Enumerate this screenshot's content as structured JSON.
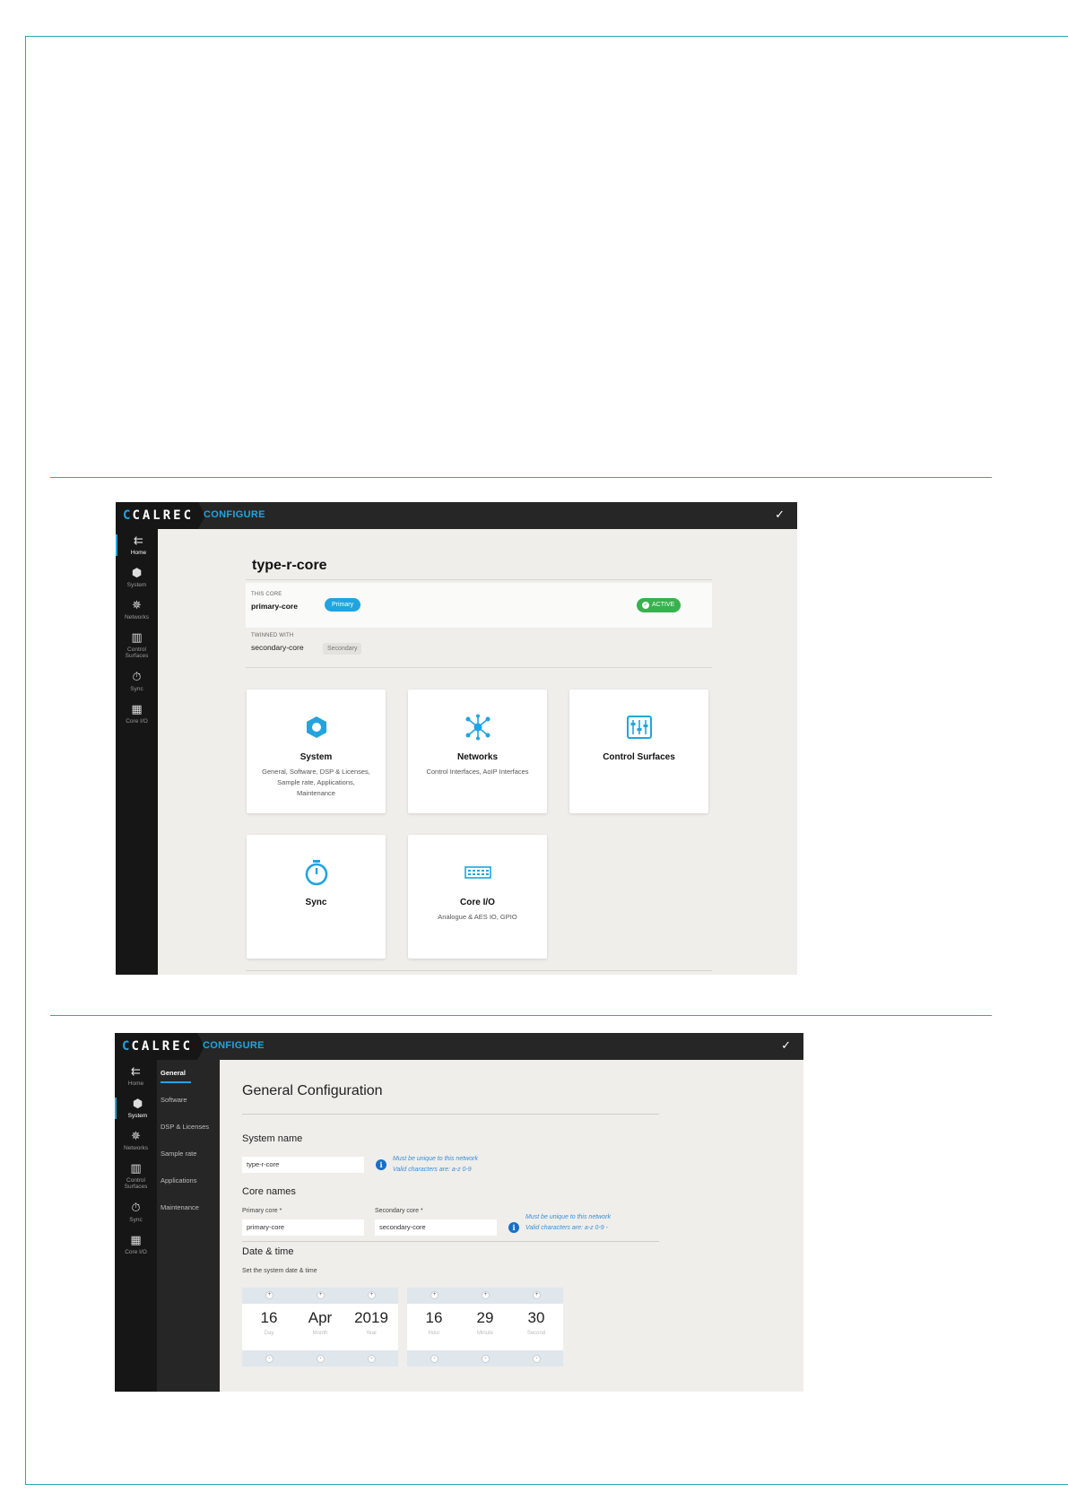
{
  "screen1": {
    "brand": {
      "logo": "CALREC",
      "section": "CONFIGURE",
      "confirm_icon": "✓"
    },
    "rail": [
      {
        "icon": "home-arrow-icon",
        "glyph": "⇇",
        "label": "Home",
        "active": true
      },
      {
        "icon": "hexagon-icon",
        "glyph": "⬢",
        "label": "System"
      },
      {
        "icon": "network-icon",
        "glyph": "✵",
        "label": "Networks"
      },
      {
        "icon": "faders-icon",
        "glyph": "▥",
        "label": "Control Surfaces"
      },
      {
        "icon": "stopwatch-icon",
        "glyph": "⏱",
        "label": "Sync"
      },
      {
        "icon": "io-ports-icon",
        "glyph": "▦",
        "label": "Core I/O"
      }
    ],
    "core_title": "type-r-core",
    "this_core": {
      "caption": "THIS CORE",
      "name": "primary-core",
      "role": "Primary",
      "status": "ACTIVE"
    },
    "twinned": {
      "caption": "TWINNED WITH",
      "name": "secondary-core",
      "role": "Secondary"
    },
    "cards": [
      {
        "title": "System",
        "subtitle": "General, Software, DSP & Licenses, Sample rate, Applications, Maintenance",
        "icon": "hexagon-icon"
      },
      {
        "title": "Networks",
        "subtitle": "Control Interfaces, AoIP Interfaces",
        "icon": "network-icon"
      },
      {
        "title": "Control Surfaces",
        "subtitle": "",
        "icon": "faders-icon"
      },
      {
        "title": "Sync",
        "subtitle": "",
        "icon": "stopwatch-icon"
      },
      {
        "title": "Core I/O",
        "subtitle": "Analogue & AES IO, GPIO",
        "icon": "io-ports-icon"
      }
    ],
    "colors": {
      "accent": "#21a4e0",
      "active": "#37b24d",
      "chrome": "#262626"
    }
  },
  "screen2": {
    "brand": {
      "logo": "CALREC",
      "section": "CONFIGURE",
      "confirm_icon": "✓"
    },
    "rail": [
      {
        "icon": "home-arrow-icon",
        "glyph": "⇇",
        "label": "Home"
      },
      {
        "icon": "hexagon-icon",
        "glyph": "⬢",
        "label": "System",
        "active": true
      },
      {
        "icon": "network-icon",
        "glyph": "✵",
        "label": "Networks"
      },
      {
        "icon": "faders-icon",
        "glyph": "▥",
        "label": "Control Surfaces"
      },
      {
        "icon": "stopwatch-icon",
        "glyph": "⏱",
        "label": "Sync"
      },
      {
        "icon": "io-ports-icon",
        "glyph": "▦",
        "label": "Core I/O"
      }
    ],
    "subnav": [
      "General",
      "Software",
      "DSP & Licenses",
      "Sample rate",
      "Applications",
      "Maintenance"
    ],
    "title": "General Configuration",
    "system_name": {
      "heading": "System name",
      "value": "type-r-core",
      "hint1": "Must be unique to this network",
      "hint2": "Valid characters are: a-z 0-9"
    },
    "core_names": {
      "heading": "Core names",
      "primary_label": "Primary core *",
      "primary_value": "primary-core",
      "secondary_label": "Secondary core *",
      "secondary_value": "secondary-core",
      "hint1": "Must be unique to this network",
      "hint2": "Valid characters are: a-z 0-9 -"
    },
    "datetime": {
      "heading": "Date & time",
      "note": "Set the system date & time",
      "date": [
        {
          "value": "16",
          "label": "Day"
        },
        {
          "value": "Apr",
          "label": "Month"
        },
        {
          "value": "2019",
          "label": "Year"
        }
      ],
      "time": [
        {
          "value": "16",
          "label": "Hour"
        },
        {
          "value": "29",
          "label": "Minute"
        },
        {
          "value": "30",
          "label": "Second"
        }
      ]
    }
  }
}
